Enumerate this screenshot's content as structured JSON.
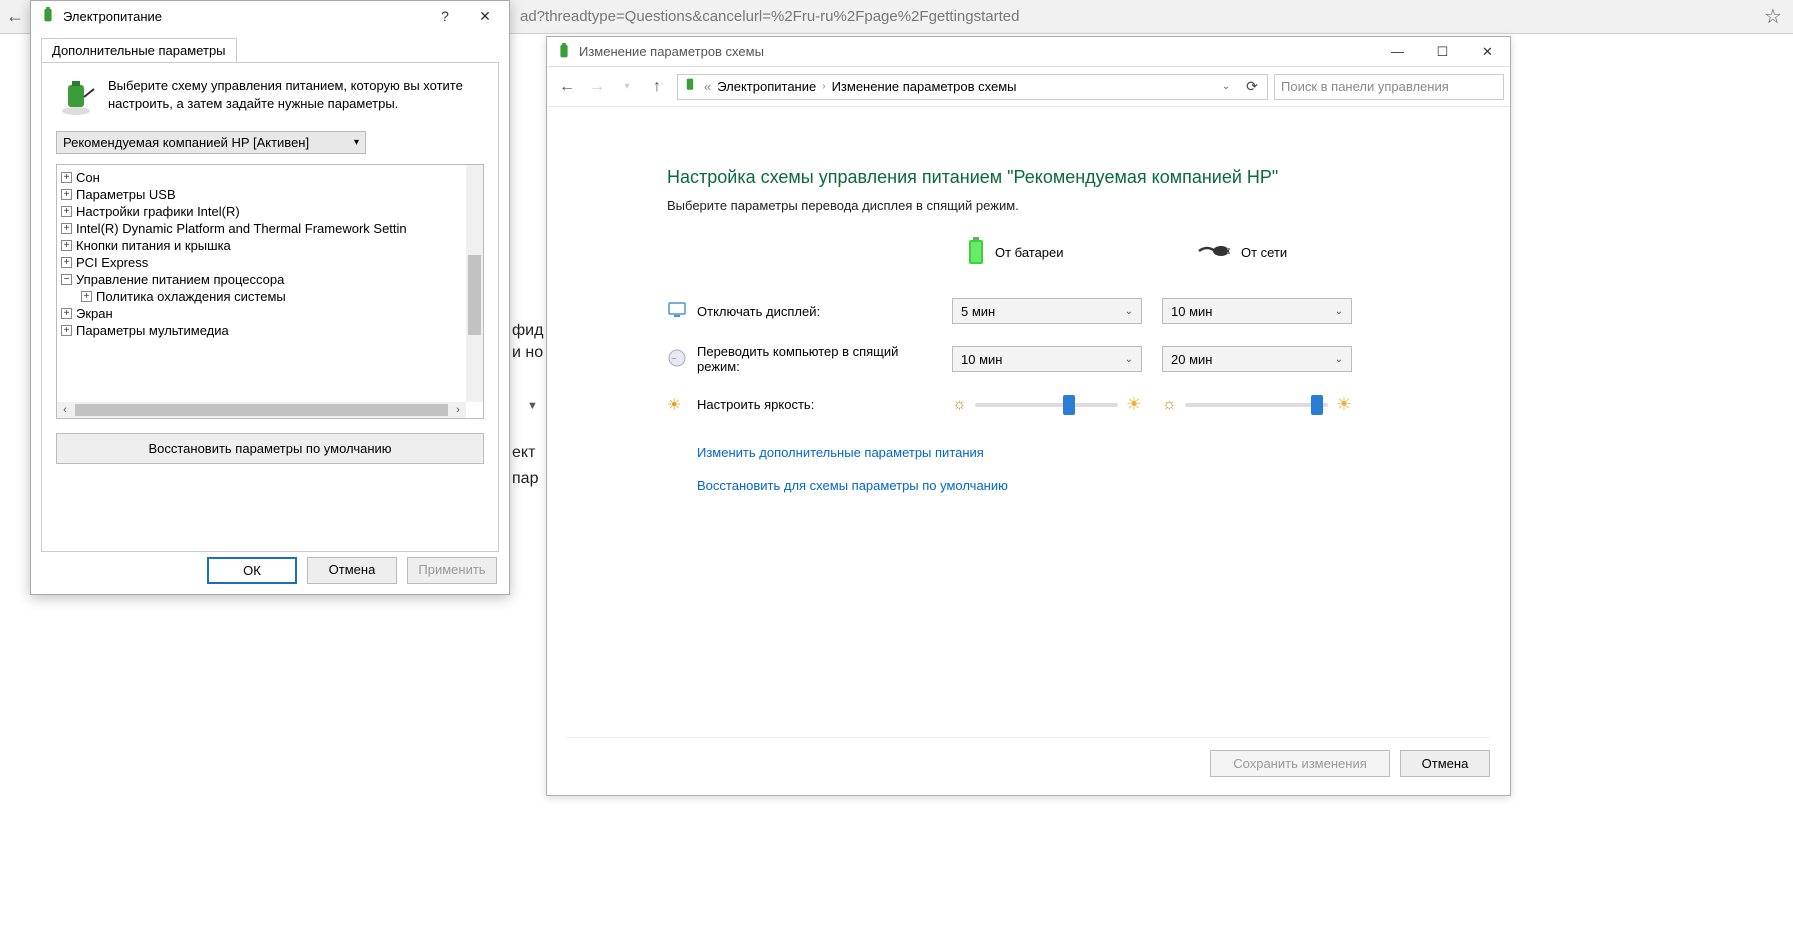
{
  "browser": {
    "url_fragment": "ad?threadtype=Questions&cancelurl=%2Fru-ru%2Fpage%2Fgettingstarted"
  },
  "dialog1": {
    "title": "Электропитание",
    "tab": "Дополнительные параметры",
    "intro": "Выберите схему управления питанием, которую вы хотите настроить, а затем задайте нужные параметры.",
    "plan": "Рекомендуемая компанией HP [Активен]",
    "tree": [
      {
        "label": "Сон",
        "exp": "+",
        "child": false
      },
      {
        "label": "Параметры USB",
        "exp": "+",
        "child": false
      },
      {
        "label": "Настройки графики Intel(R)",
        "exp": "+",
        "child": false
      },
      {
        "label": "Intel(R) Dynamic Platform and Thermal Framework Settin",
        "exp": "+",
        "child": false
      },
      {
        "label": "Кнопки питания и крышка",
        "exp": "+",
        "child": false
      },
      {
        "label": "PCI Express",
        "exp": "+",
        "child": false
      },
      {
        "label": "Управление питанием процессора",
        "exp": "−",
        "child": false
      },
      {
        "label": "Политика охлаждения системы",
        "exp": "+",
        "child": true
      },
      {
        "label": "Экран",
        "exp": "+",
        "child": false
      },
      {
        "label": "Параметры мультимедиа",
        "exp": "+",
        "child": false
      }
    ],
    "restore": "Восстановить параметры по умолчанию",
    "ok": "ОК",
    "cancel": "Отмена",
    "apply": "Применить"
  },
  "window2": {
    "title": "Изменение параметров схемы",
    "crumb1": "Электропитание",
    "crumb2": "Изменение параметров схемы",
    "search_placeholder": "Поиск в панели управления",
    "h1": "Настройка схемы управления питанием \"Рекомендуемая компанией HP\"",
    "subtitle": "Выберите параметры перевода дисплея в спящий режим.",
    "col_battery": "От батареи",
    "col_ac": "От сети",
    "row_display": "Отключать дисплей:",
    "row_sleep": "Переводить компьютер в спящий режим:",
    "row_brightness": "Настроить яркость:",
    "val_display_batt": "5 мин",
    "val_display_ac": "10 мин",
    "val_sleep_batt": "10 мин",
    "val_sleep_ac": "20 мин",
    "link1": "Изменить дополнительные параметры питания",
    "link2": "Восстановить для схемы параметры по умолчанию",
    "save": "Сохранить изменения",
    "cancel": "Отмена"
  },
  "bg": {
    "t1": "фид",
    "t2": "и но",
    "t3": "ект",
    "t4": "пар"
  }
}
